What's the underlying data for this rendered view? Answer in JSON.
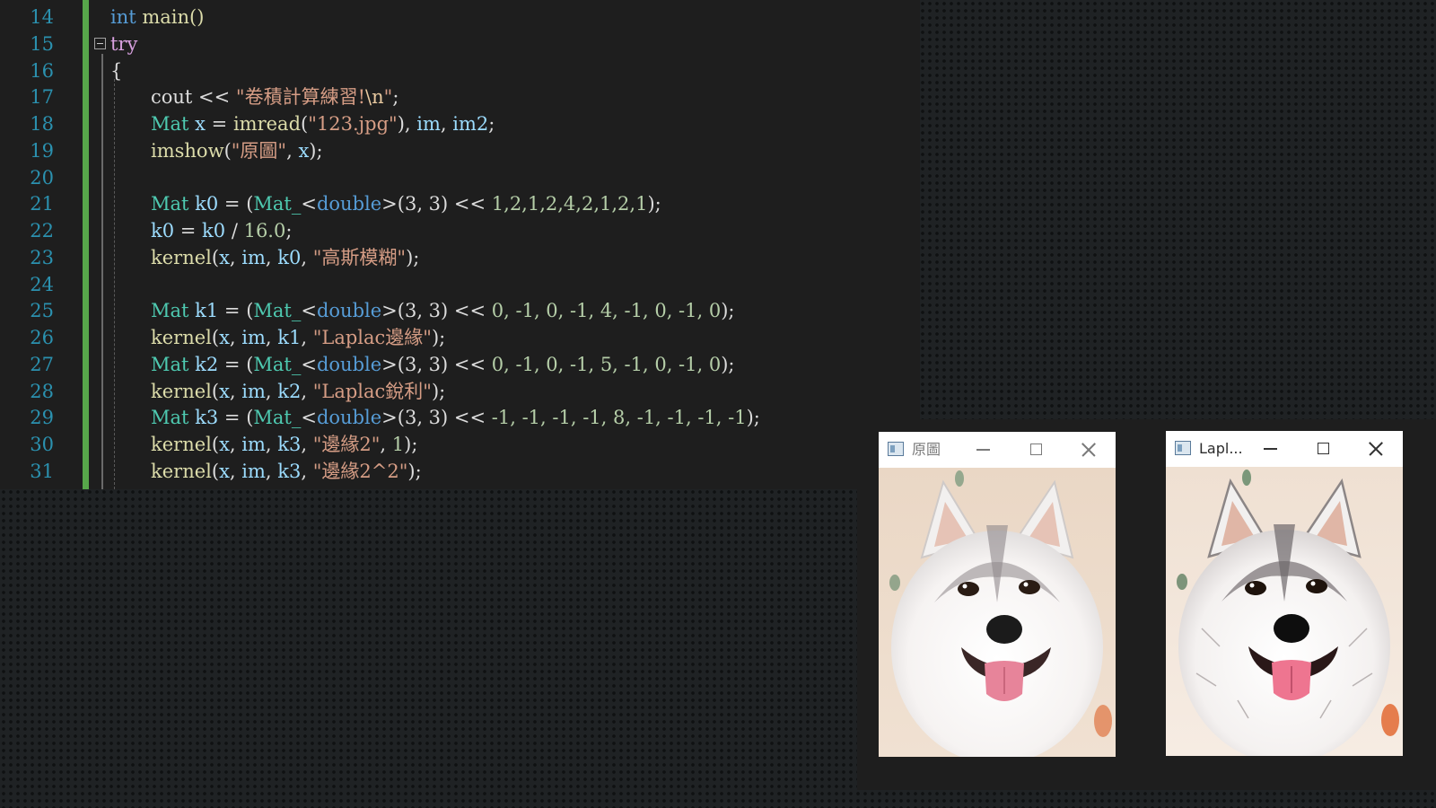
{
  "editor": {
    "line_numbers": [
      "14",
      "15",
      "16",
      "17",
      "18",
      "19",
      "20",
      "21",
      "22",
      "23",
      "24",
      "25",
      "26",
      "27",
      "28",
      "29",
      "30",
      "31"
    ],
    "lines": [
      {
        "tokens": [
          {
            "t": "int",
            "c": "kw"
          },
          {
            "t": " main()",
            "c": "fn"
          }
        ]
      },
      {
        "tokens": [
          {
            "t": "try",
            "c": "kw2"
          }
        ]
      },
      {
        "tokens": [
          {
            "t": "{",
            "c": "pl"
          }
        ]
      },
      {
        "tokens": [
          {
            "t": "cout << ",
            "c": "pl"
          },
          {
            "t": "\"卷積計算練習!",
            "c": "str"
          },
          {
            "t": "\\n",
            "c": "esc"
          },
          {
            "t": "\"",
            "c": "str"
          },
          {
            "t": ";",
            "c": "pl"
          }
        ]
      },
      {
        "tokens": [
          {
            "t": "Mat",
            "c": "ty"
          },
          {
            "t": " ",
            "c": "pl"
          },
          {
            "t": "x",
            "c": "var"
          },
          {
            "t": " = ",
            "c": "pl"
          },
          {
            "t": "imread",
            "c": "fn"
          },
          {
            "t": "(",
            "c": "pl"
          },
          {
            "t": "\"123.jpg\"",
            "c": "str"
          },
          {
            "t": "), ",
            "c": "pl"
          },
          {
            "t": "im",
            "c": "var"
          },
          {
            "t": ", ",
            "c": "pl"
          },
          {
            "t": "im2",
            "c": "var"
          },
          {
            "t": ";",
            "c": "pl"
          }
        ]
      },
      {
        "tokens": [
          {
            "t": "imshow",
            "c": "fn"
          },
          {
            "t": "(",
            "c": "pl"
          },
          {
            "t": "\"原圖\"",
            "c": "str"
          },
          {
            "t": ", ",
            "c": "pl"
          },
          {
            "t": "x",
            "c": "var"
          },
          {
            "t": ");",
            "c": "pl"
          }
        ]
      },
      {
        "tokens": []
      },
      {
        "tokens": [
          {
            "t": "Mat",
            "c": "ty"
          },
          {
            "t": " ",
            "c": "pl"
          },
          {
            "t": "k0",
            "c": "var"
          },
          {
            "t": " = (",
            "c": "pl"
          },
          {
            "t": "Mat_",
            "c": "ty"
          },
          {
            "t": "<",
            "c": "pl"
          },
          {
            "t": "double",
            "c": "kw"
          },
          {
            "t": ">(3, 3) << ",
            "c": "pl"
          },
          {
            "t": "1,2,1,2,4,2,1,2,1",
            "c": "num"
          },
          {
            "t": ");",
            "c": "pl"
          }
        ]
      },
      {
        "tokens": [
          {
            "t": "k0",
            "c": "var"
          },
          {
            "t": " = ",
            "c": "pl"
          },
          {
            "t": "k0",
            "c": "var"
          },
          {
            "t": " / ",
            "c": "pl"
          },
          {
            "t": "16.0",
            "c": "num"
          },
          {
            "t": ";",
            "c": "pl"
          }
        ]
      },
      {
        "tokens": [
          {
            "t": "kernel",
            "c": "fn"
          },
          {
            "t": "(",
            "c": "pl"
          },
          {
            "t": "x",
            "c": "var"
          },
          {
            "t": ", ",
            "c": "pl"
          },
          {
            "t": "im",
            "c": "var"
          },
          {
            "t": ", ",
            "c": "pl"
          },
          {
            "t": "k0",
            "c": "var"
          },
          {
            "t": ", ",
            "c": "pl"
          },
          {
            "t": "\"高斯模糊\"",
            "c": "str"
          },
          {
            "t": ");",
            "c": "pl"
          }
        ]
      },
      {
        "tokens": []
      },
      {
        "tokens": [
          {
            "t": "Mat",
            "c": "ty"
          },
          {
            "t": " ",
            "c": "pl"
          },
          {
            "t": "k1",
            "c": "var"
          },
          {
            "t": " = (",
            "c": "pl"
          },
          {
            "t": "Mat_",
            "c": "ty"
          },
          {
            "t": "<",
            "c": "pl"
          },
          {
            "t": "double",
            "c": "kw"
          },
          {
            "t": ">(3, 3) << ",
            "c": "pl"
          },
          {
            "t": "0, -1, 0, -1, 4, -1, 0, -1, 0",
            "c": "num"
          },
          {
            "t": ");",
            "c": "pl"
          }
        ]
      },
      {
        "tokens": [
          {
            "t": "kernel",
            "c": "fn"
          },
          {
            "t": "(",
            "c": "pl"
          },
          {
            "t": "x",
            "c": "var"
          },
          {
            "t": ", ",
            "c": "pl"
          },
          {
            "t": "im",
            "c": "var"
          },
          {
            "t": ", ",
            "c": "pl"
          },
          {
            "t": "k1",
            "c": "var"
          },
          {
            "t": ", ",
            "c": "pl"
          },
          {
            "t": "\"Laplac邊緣\"",
            "c": "str"
          },
          {
            "t": ");",
            "c": "pl"
          }
        ]
      },
      {
        "tokens": [
          {
            "t": "Mat",
            "c": "ty"
          },
          {
            "t": " ",
            "c": "pl"
          },
          {
            "t": "k2",
            "c": "var"
          },
          {
            "t": " = (",
            "c": "pl"
          },
          {
            "t": "Mat_",
            "c": "ty"
          },
          {
            "t": "<",
            "c": "pl"
          },
          {
            "t": "double",
            "c": "kw"
          },
          {
            "t": ">(3, 3) << ",
            "c": "pl"
          },
          {
            "t": "0, -1, 0, -1, 5, -1, 0, -1, 0",
            "c": "num"
          },
          {
            "t": ");",
            "c": "pl"
          }
        ]
      },
      {
        "tokens": [
          {
            "t": "kernel",
            "c": "fn"
          },
          {
            "t": "(",
            "c": "pl"
          },
          {
            "t": "x",
            "c": "var"
          },
          {
            "t": ", ",
            "c": "pl"
          },
          {
            "t": "im",
            "c": "var"
          },
          {
            "t": ", ",
            "c": "pl"
          },
          {
            "t": "k2",
            "c": "var"
          },
          {
            "t": ", ",
            "c": "pl"
          },
          {
            "t": "\"Laplac銳利\"",
            "c": "str"
          },
          {
            "t": ");",
            "c": "pl"
          }
        ]
      },
      {
        "tokens": [
          {
            "t": "Mat",
            "c": "ty"
          },
          {
            "t": " ",
            "c": "pl"
          },
          {
            "t": "k3",
            "c": "var"
          },
          {
            "t": " = (",
            "c": "pl"
          },
          {
            "t": "Mat_",
            "c": "ty"
          },
          {
            "t": "<",
            "c": "pl"
          },
          {
            "t": "double",
            "c": "kw"
          },
          {
            "t": ">(3, 3) << ",
            "c": "pl"
          },
          {
            "t": "-1, -1, -1, -1, 8, -1, -1, -1, -1",
            "c": "num"
          },
          {
            "t": ");",
            "c": "pl"
          }
        ]
      },
      {
        "tokens": [
          {
            "t": "kernel",
            "c": "fn"
          },
          {
            "t": "(",
            "c": "pl"
          },
          {
            "t": "x",
            "c": "var"
          },
          {
            "t": ", ",
            "c": "pl"
          },
          {
            "t": "im",
            "c": "var"
          },
          {
            "t": ", ",
            "c": "pl"
          },
          {
            "t": "k3",
            "c": "var"
          },
          {
            "t": ", ",
            "c": "pl"
          },
          {
            "t": "\"邊緣2\"",
            "c": "str"
          },
          {
            "t": ", ",
            "c": "pl"
          },
          {
            "t": "1",
            "c": "num"
          },
          {
            "t": ");",
            "c": "pl"
          }
        ]
      },
      {
        "tokens": [
          {
            "t": "kernel",
            "c": "fn"
          },
          {
            "t": "(",
            "c": "pl"
          },
          {
            "t": "x",
            "c": "var"
          },
          {
            "t": ", ",
            "c": "pl"
          },
          {
            "t": "im",
            "c": "var"
          },
          {
            "t": ", ",
            "c": "pl"
          },
          {
            "t": "k3",
            "c": "var"
          },
          {
            "t": ", ",
            "c": "pl"
          },
          {
            "t": "\"邊緣2^2\"",
            "c": "str"
          },
          {
            "t": ");",
            "c": "pl"
          }
        ]
      }
    ]
  },
  "windows": [
    {
      "title": "原圖",
      "active": false,
      "sharp": false
    },
    {
      "title": "Lapl...",
      "active": true,
      "sharp": true
    }
  ],
  "icons": {
    "window_icon": "image-window-icon",
    "minimize": "minimize-icon",
    "maximize": "maximize-icon",
    "close": "close-icon"
  }
}
